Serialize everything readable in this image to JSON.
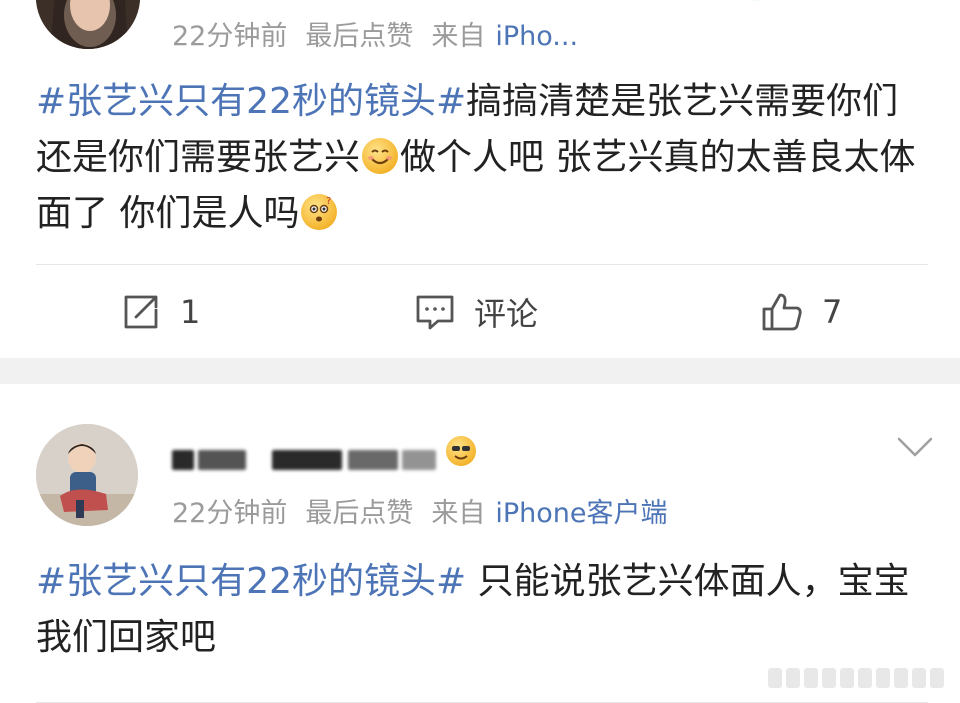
{
  "posts": [
    {
      "meta": {
        "time": "22分钟前",
        "liked": "最后点赞",
        "from": "来自",
        "device": "iPho..."
      },
      "content": {
        "topic": "#张艺兴只有22秒的镜头#",
        "text1": "搞搞清楚是张艺兴需要你们还是你们需要张艺兴",
        "text2": "做个人吧 张艺兴真的太善良太体面了 你们是人吗"
      },
      "actions": {
        "repost_count": "1",
        "comment_label": "评论",
        "like_count": "7"
      },
      "emojis": [
        "smile-emoji",
        "confused-emoji"
      ]
    },
    {
      "meta": {
        "time": "22分钟前",
        "liked": "最后点赞",
        "from": "来自",
        "device": "iPhone客户端"
      },
      "content": {
        "topic": "#张艺兴只有22秒的镜头#",
        "text1": " 只能说张艺兴体面人，宝宝我们回家吧"
      }
    }
  ],
  "colors": {
    "link": "#4c74b6",
    "meta": "#9b9b9b",
    "separator": "#f1f1f1"
  }
}
